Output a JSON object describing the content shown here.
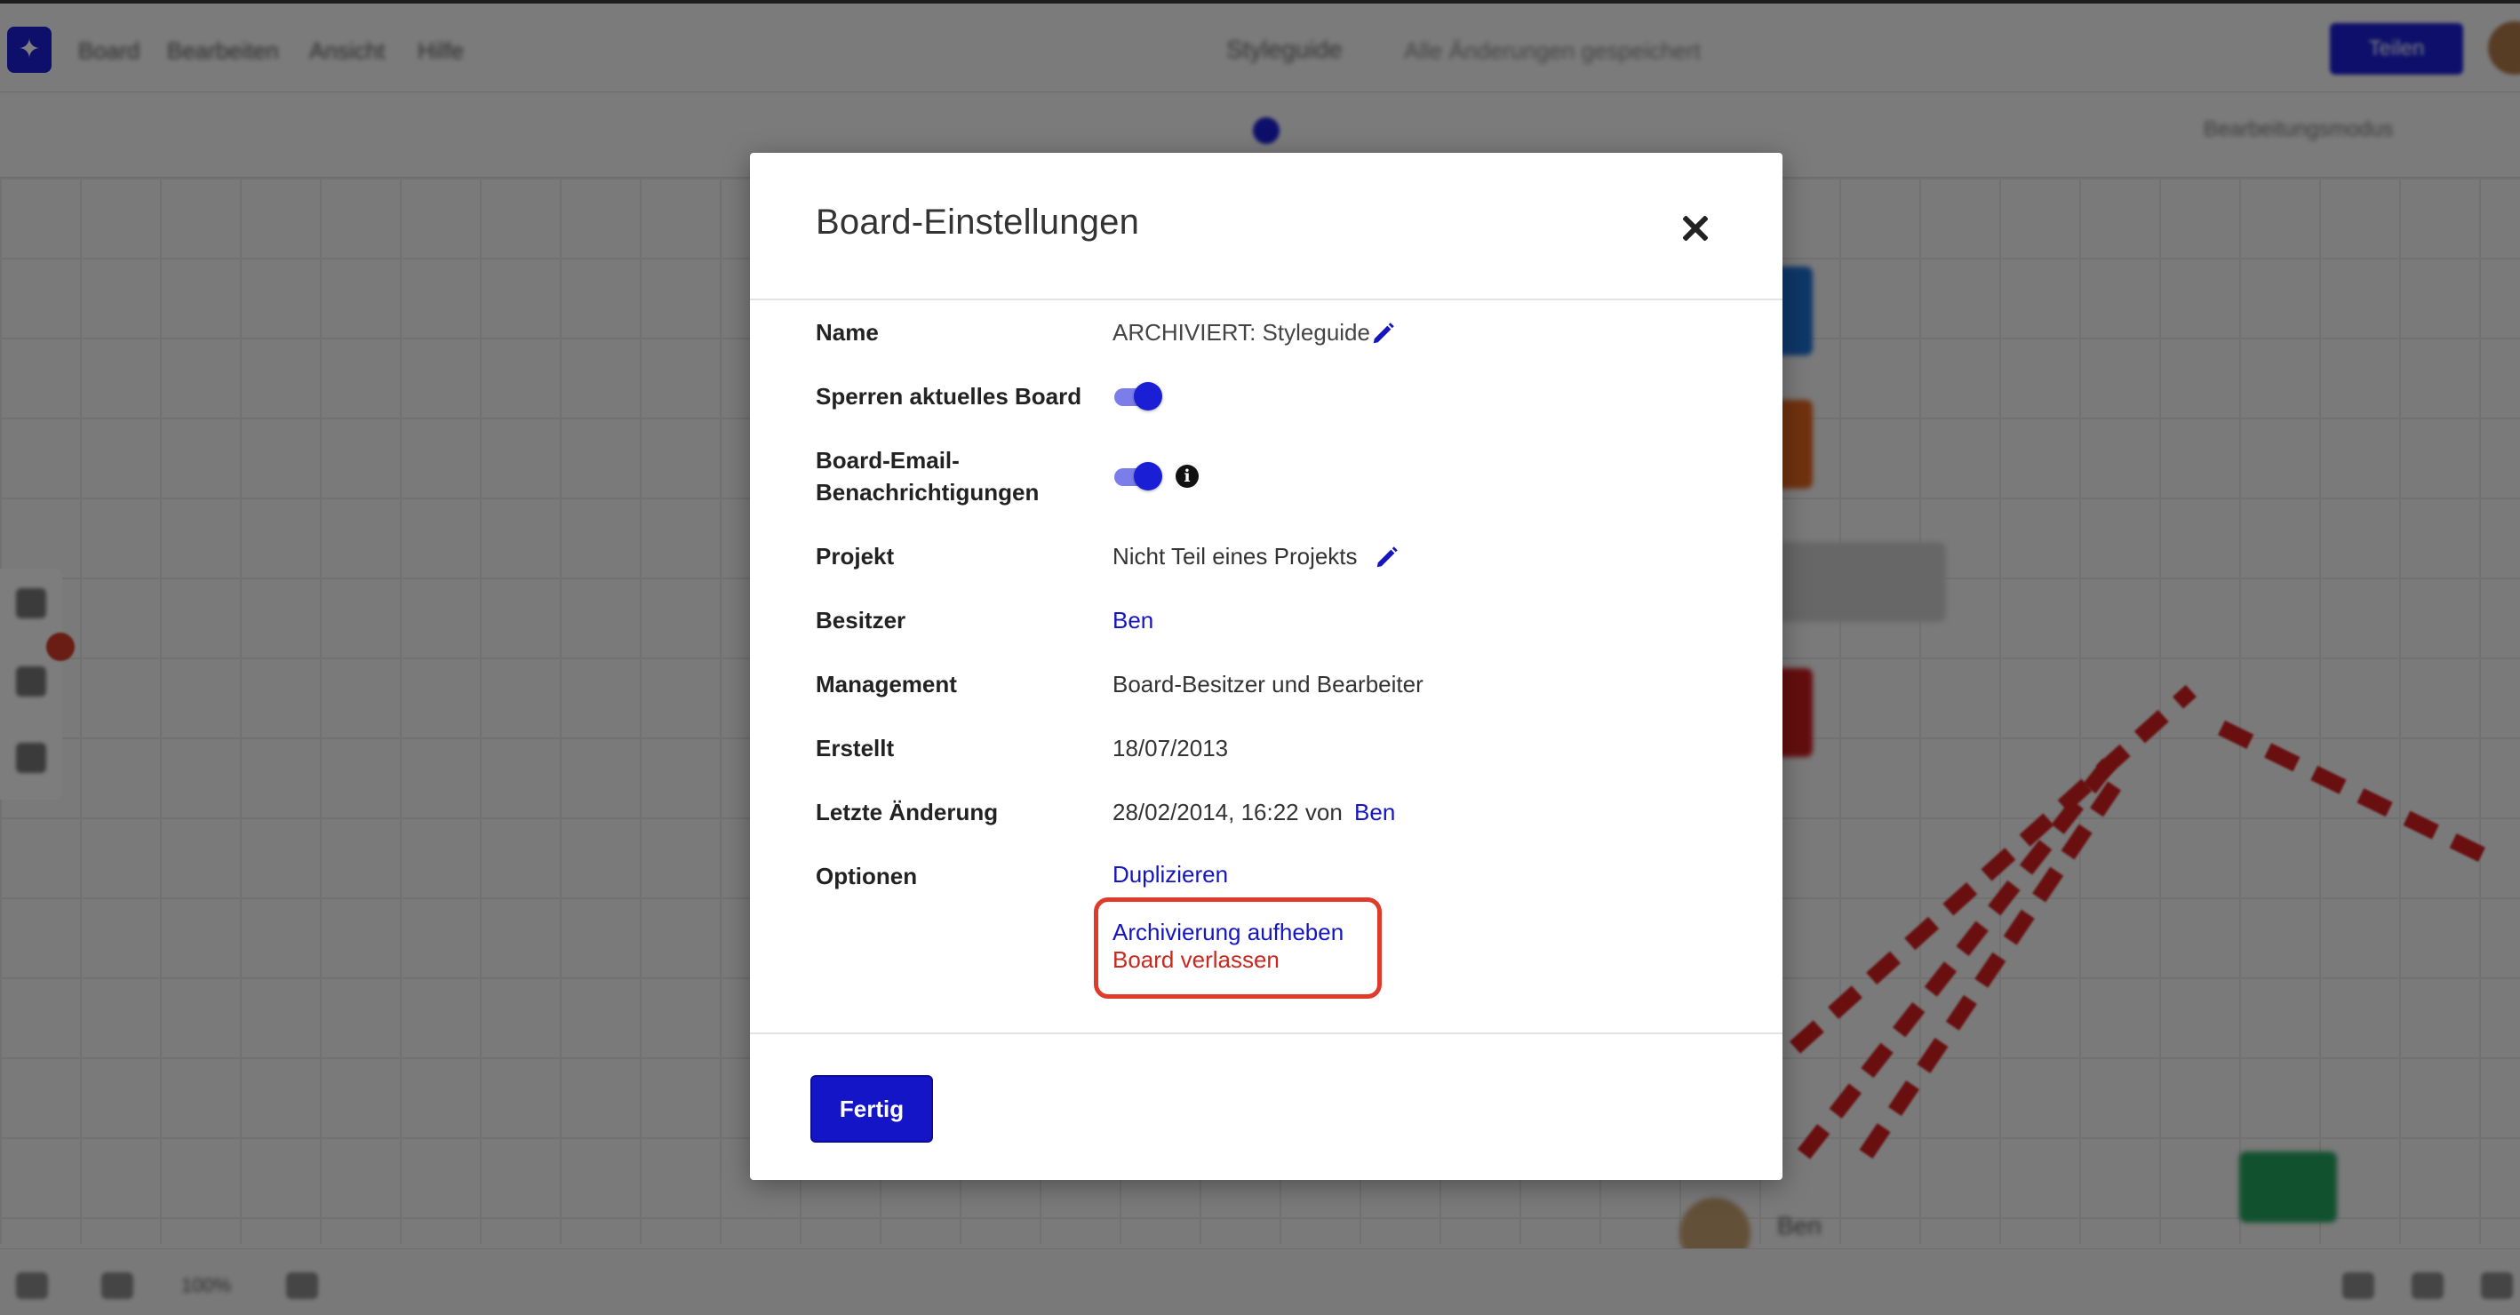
{
  "background": {
    "menu": [
      "Board",
      "Bearbeiten",
      "Ansicht",
      "Hilfe"
    ],
    "board_title": "Styleguide",
    "saved_text": "Alle Änderungen gespeichert",
    "share_label": "Teilen",
    "sub_label": "Bearbeitungsmodus",
    "zoom": "100%",
    "user_name": "Ben"
  },
  "modal": {
    "title": "Board-Einstellungen",
    "rows": {
      "name": {
        "label": "Name",
        "value": "ARCHIVIERT: Styleguide"
      },
      "lock": {
        "label": "Sperren aktuelles Board",
        "on": true
      },
      "email": {
        "label_line1": "Board-Email-",
        "label_line2": "Benachrichtigungen",
        "on": true
      },
      "project": {
        "label": "Projekt",
        "value": "Nicht Teil eines Projekts"
      },
      "owner": {
        "label": "Besitzer",
        "value": "Ben"
      },
      "management": {
        "label": "Management",
        "value": "Board-Besitzer und Bearbeiter"
      },
      "created": {
        "label": "Erstellt",
        "value": "18/07/2013"
      },
      "modified": {
        "label": "Letzte Änderung",
        "value": "28/02/2014, 16:22 von",
        "user": "Ben"
      },
      "options": {
        "label": "Optionen",
        "duplicate": "Duplizieren",
        "unarchive": "Archivierung aufheben",
        "leave": "Board verlassen"
      }
    },
    "done_label": "Fertig"
  },
  "colors": {
    "accent": "#1515c8",
    "link": "#1515c0",
    "danger": "#c8281e",
    "highlight": "#e03a2a",
    "toggle_track": "#7b7ee8"
  },
  "icons": [
    "close-icon",
    "pencil-icon",
    "info-icon"
  ]
}
